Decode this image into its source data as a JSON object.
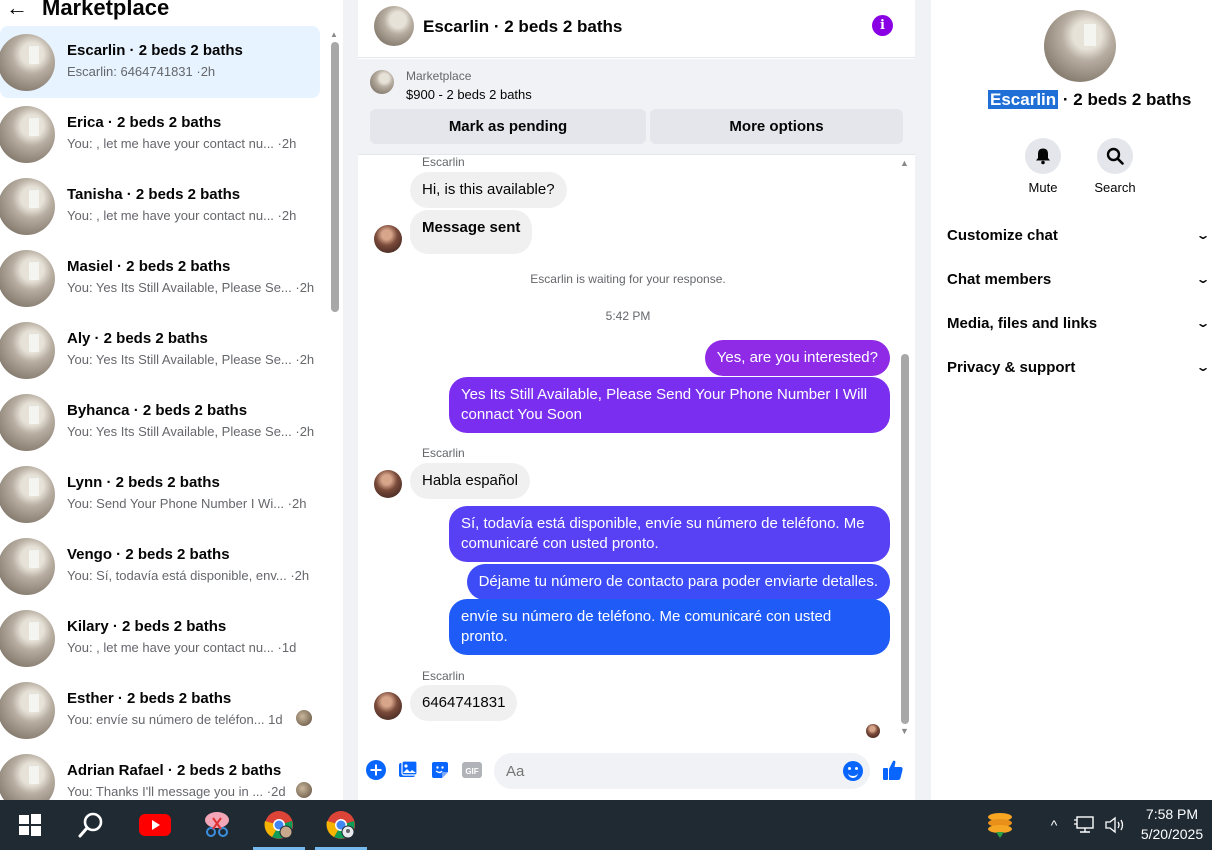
{
  "left": {
    "title": "Marketplace",
    "conversations": [
      {
        "name": "Escarlin · 2 beds 2 baths",
        "preview": "Escarlin: 6464741831 ·2h",
        "active": true
      },
      {
        "name": "Erica · 2 beds 2 baths",
        "preview": "You: , let me have your contact nu...  ·2h"
      },
      {
        "name": "Tanisha · 2 beds 2 baths",
        "preview": "You: , let me have your contact nu...  ·2h"
      },
      {
        "name": "Masiel · 2 beds 2 baths",
        "preview": "You: Yes Its Still Available, Please Se... ·2h"
      },
      {
        "name": "Aly · 2 beds 2 baths",
        "preview": "You: Yes Its Still Available, Please Se... ·2h"
      },
      {
        "name": "Byhanca · 2 beds 2 baths",
        "preview": "You: Yes Its Still Available, Please Se... ·2h"
      },
      {
        "name": "Lynn · 2 beds 2 baths",
        "preview": "You: Send Your Phone Number I Wi... ·2h"
      },
      {
        "name": "Vengo · 2 beds 2 baths",
        "preview": "You: Sí, todavía está disponible, env... ·2h"
      },
      {
        "name": "Kilary · 2 beds 2 baths",
        "preview": "You: , let me have your contact nu...  ·1d"
      },
      {
        "name": "Esther · 2 beds 2 baths",
        "preview": "You: envíe su número de teléfon...  1d"
      },
      {
        "name": "Adrian Rafael · 2 beds 2 baths",
        "preview": "You: Thanks I'll message you in ...  ·2d"
      }
    ]
  },
  "chat": {
    "title": "Escarlin · 2 beds 2 baths",
    "listing_source": "Marketplace",
    "listing_price": "$900 - 2 beds 2 baths",
    "mark_pending": "Mark as pending",
    "more_options": "More options",
    "sender_name": "Escarlin",
    "msg1": "Hi, is this available?",
    "msg2": "Message sent",
    "waiting": "Escarlin is waiting for your response.",
    "time": "5:42 PM",
    "out1": "Yes, are you interested?",
    "out2": "Yes Its Still Available, Please Send Your Phone Number I Will connact You Soon",
    "in3": "Habla español",
    "out3": "Sí, todavía está disponible, envíe su número de teléfono. Me comunicaré con usted pronto.",
    "out4": "Déjame tu número de contacto para poder enviarte detalles.",
    "out5": "envíe su número de teléfono. Me comunicaré con usted pronto.",
    "in4": "6464741831",
    "composer_placeholder": "Aa"
  },
  "right": {
    "title_highlight": "Escarlin",
    "title_rest": " · 2 beds 2 baths",
    "mute": "Mute",
    "search": "Search",
    "sections": [
      "Customize chat",
      "Chat members",
      "Media, files and links",
      "Privacy & support"
    ]
  },
  "taskbar": {
    "time": "7:58 PM",
    "date": "5/20/2025"
  },
  "colors": {
    "accent": "#0866ff",
    "purple": "#8a00e5",
    "highlight": "#1f6fd6",
    "taskbar": "#1f2a33"
  }
}
